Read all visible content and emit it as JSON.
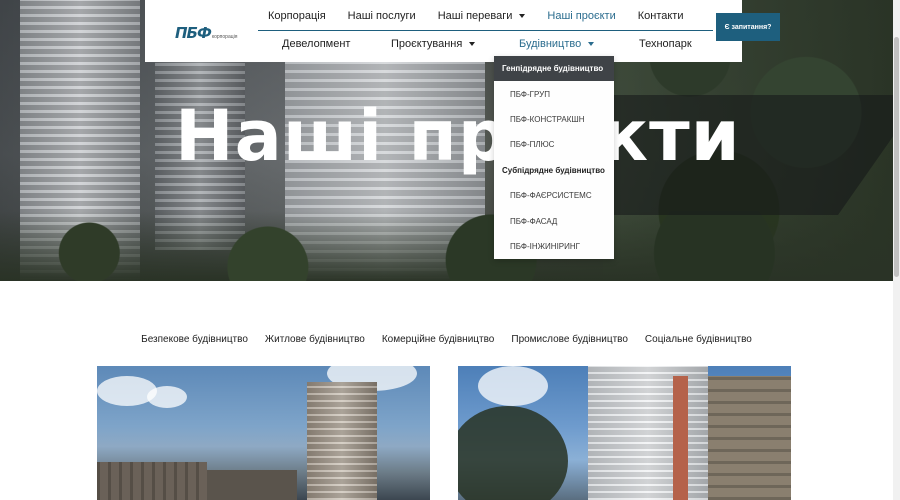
{
  "hero": {
    "title": "Наші проєкти"
  },
  "header": {
    "logo": {
      "mark": "ПБФ",
      "subtitle": "корпорація"
    },
    "nav_top": [
      {
        "label": "Корпорація",
        "has_caret": false,
        "active": false
      },
      {
        "label": "Наші послуги",
        "has_caret": false,
        "active": false
      },
      {
        "label": "Наші переваги",
        "has_caret": true,
        "active": false
      },
      {
        "label": "Наші проєкти",
        "has_caret": false,
        "active": true
      },
      {
        "label": "Контакти",
        "has_caret": false,
        "active": false
      }
    ],
    "nav_sub": [
      {
        "label": "Девелопмент",
        "has_caret": false,
        "active": false
      },
      {
        "label": "Проєктування",
        "has_caret": true,
        "active": false
      },
      {
        "label": "Будівництво",
        "has_caret": true,
        "active": true
      },
      {
        "label": "Технопарк",
        "has_caret": false,
        "active": false
      }
    ],
    "cta_label": "Є запитання?"
  },
  "dropdown": {
    "items": [
      {
        "label": "Генпідрядне будівництво",
        "type": "group",
        "highlight": true
      },
      {
        "label": "ПБФ-ГРУП",
        "type": "item"
      },
      {
        "label": "ПБФ-КОНСТРАКШН",
        "type": "item"
      },
      {
        "label": "ПБФ-ПЛЮС",
        "type": "item"
      },
      {
        "label": "Субпідрядне будівництво",
        "type": "group"
      },
      {
        "label": "ПБФ-ФАЄРСИСТЕМС",
        "type": "item"
      },
      {
        "label": "ПБФ-ФАСАД",
        "type": "item"
      },
      {
        "label": "ПБФ-ІНЖИНІРИНГ",
        "type": "item"
      }
    ]
  },
  "categories": [
    "Безпекове будівництво",
    "Житлове будівництво",
    "Комерційне будівництво",
    "Промислове будівництво",
    "Соціальне будівництво"
  ],
  "colors": {
    "brand": "#1e5f7e",
    "active_link": "#2a6c8e",
    "dropdown_highlight": "#3f4347"
  }
}
